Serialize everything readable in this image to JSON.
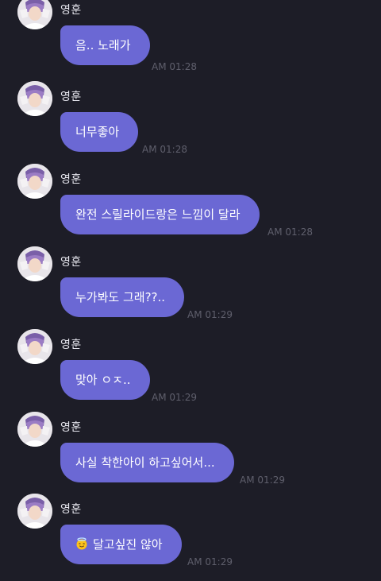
{
  "chat": {
    "messages": [
      {
        "sender": "영훈",
        "text": "음.. 노래가",
        "time": "AM 01:28"
      },
      {
        "sender": "영훈",
        "text": "너무좋아",
        "time": "AM 01:28"
      },
      {
        "sender": "영훈",
        "text": "완전 스릴라이드랑은 느낌이 달라",
        "time": "AM 01:28"
      },
      {
        "sender": "영훈",
        "text": "누가봐도 그래??..",
        "time": "AM 01:29"
      },
      {
        "sender": "영훈",
        "text": "맞아 ㅇㅈ..",
        "time": "AM 01:29"
      },
      {
        "sender": "영훈",
        "text": "사실 착한아이 하고싶어서...",
        "time": "AM 01:29"
      },
      {
        "sender": "영훈",
        "text": "달고싶진 않아",
        "time": "AM 01:29",
        "emoji": "smiling-face-with-halo"
      }
    ]
  }
}
